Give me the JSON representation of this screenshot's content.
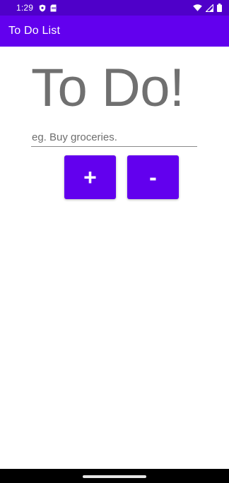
{
  "status_bar": {
    "time": "1:29",
    "icons": [
      "shield-icon",
      "sim-card-icon",
      "wifi-icon",
      "signal-icon",
      "battery-icon"
    ]
  },
  "app_bar": {
    "title": "To Do List"
  },
  "main": {
    "heading": "To Do!",
    "task_input": {
      "value": "",
      "placeholder": "eg. Buy groceries."
    },
    "add_button_label": "+",
    "remove_button_label": "-"
  },
  "colors": {
    "primary": "#6200ee",
    "primary_dark": "#4f00c9",
    "heading_text": "#707070"
  }
}
